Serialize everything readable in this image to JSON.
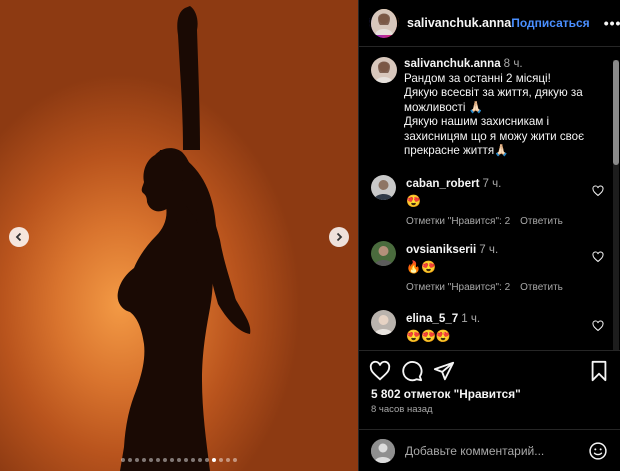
{
  "post": {
    "author": "salivanchuk.anna",
    "follow_label": "Подписаться",
    "more_label": "•••",
    "caption": {
      "time": "8 ч.",
      "lines": [
        "Рандом за останні 2 місяці!",
        "Дякую всесвіт за життя, дякую за можливості 🙏🏻",
        "Дякую нашим захисникам і захисницям що я можу жити своє прекрасне життя🙏🏻"
      ]
    },
    "comments": [
      {
        "user": "caban_robert",
        "time": "7 ч.",
        "text": "😍",
        "likes_label": "Отметки \"Нравится\": 2",
        "reply_label": "Ответить"
      },
      {
        "user": "ovsianikserii",
        "time": "7 ч.",
        "text": "🔥😍",
        "likes_label": "Отметки \"Нравится\": 2",
        "reply_label": "Ответить"
      },
      {
        "user": "elina_5_7",
        "time": "1 ч.",
        "text": "😍😍😍",
        "likes_label": "",
        "reply_label": ""
      }
    ],
    "likes": "5 802 отметок \"Нравится\"",
    "posted_ago": "8 часов назад",
    "add_comment_placeholder": "Добавьте комментарий...",
    "carousel": {
      "count": 17,
      "active_index": 13
    }
  },
  "icons": {
    "like": "heart-icon",
    "comment": "comment-bubble-icon",
    "share": "paper-plane-icon",
    "save": "bookmark-icon",
    "emoji": "smiley-icon",
    "prev": "chevron-left-icon",
    "next": "chevron-right-icon"
  },
  "colors": {
    "accent": "#4a8fff",
    "background": "#000000",
    "photo_glow": "#f39a45"
  }
}
